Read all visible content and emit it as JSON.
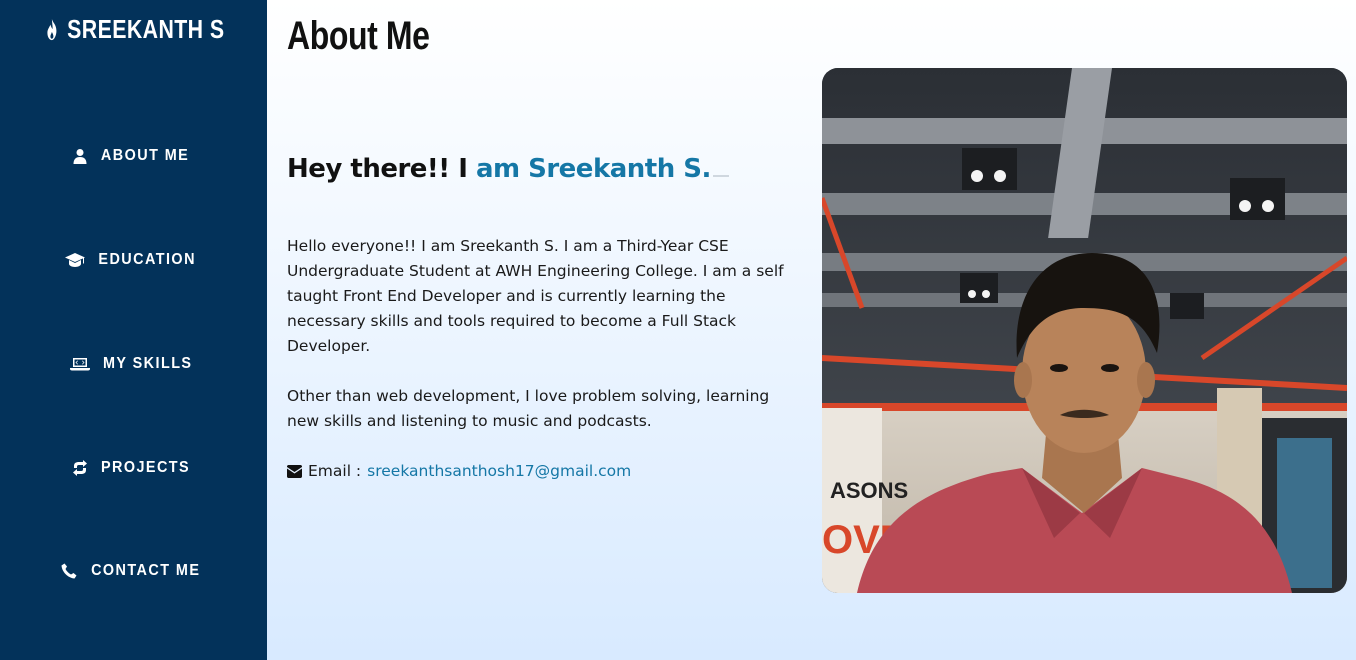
{
  "brand": {
    "name": "SREEKANTH S",
    "icon": "fire-icon"
  },
  "sidebar": {
    "items": [
      {
        "label": "ABOUT ME",
        "icon": "user-icon"
      },
      {
        "label": "EDUCATION",
        "icon": "graduation-cap-icon"
      },
      {
        "label": "MY SKILLS",
        "icon": "laptop-code-icon"
      },
      {
        "label": "PROJECTS",
        "icon": "project-diagram-icon"
      },
      {
        "label": "CONTACT ME",
        "icon": "phone-icon"
      }
    ]
  },
  "main": {
    "title": "About Me",
    "greeting": {
      "prefix": "Hey there!! I",
      "name": "am Sreekanth S."
    },
    "paragraph1": "Hello everyone!! I am Sreekanth S. I am a Third-Year CSE Undergraduate Student at AWH Engineering College. I am a self taught Front End Developer and is currently learning the necessary skills and tools required to become a Full Stack Developer.",
    "paragraph2": "Other than web development, I love problem solving, learning new skills and listening to music and podcasts.",
    "email": {
      "label": "Email :",
      "value": "sreekanthsanthosh17@gmail.com",
      "icon": "envelope-icon"
    }
  },
  "colors": {
    "sidebar_bg": "#03325a",
    "accent": "#1577a6",
    "text": "#111111"
  }
}
